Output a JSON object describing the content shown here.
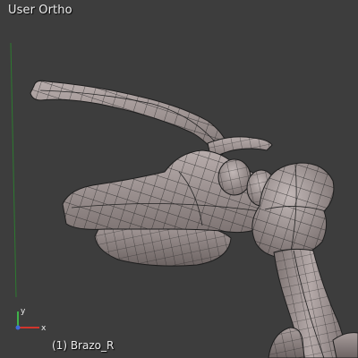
{
  "viewport": {
    "view_name": "User Ortho",
    "object_info": "(1) Brazo_R",
    "background_color": "#3d3d3d",
    "text_color": "#ededed"
  },
  "mesh": {
    "name": "Brazo_R",
    "surface_color": "#9c8f8e",
    "wire_color": "#232323"
  },
  "axis_gizmo": {
    "y_label": "y",
    "x_label": "x",
    "y_color": "#3fb24a",
    "x_color": "#d1352c",
    "z_dot_color": "#3f6ad9"
  },
  "axis_line_color": "#2d7a30"
}
